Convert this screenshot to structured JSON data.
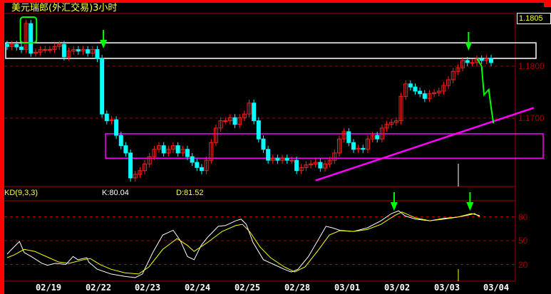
{
  "title": "美元瑞郎(外汇交易)3小时",
  "last_price": "1.1805",
  "colors": {
    "up": "#ff2020",
    "down": "#00ffff",
    "k_line": "#ffffff",
    "d_line": "#ffff00",
    "grid": "#a00000",
    "marker": "#00ff00",
    "support_box": "#ff00ff",
    "resistance_box": "#ffffff",
    "frame": "#ff0000"
  },
  "chart_data": [
    {
      "type": "candlestick",
      "title": "美元瑞郎(外汇交易)3小时",
      "y_ticks": [
        "1.1800",
        "1.1700"
      ],
      "y_tick_values": [
        1.18,
        1.17
      ],
      "x_ticks": [
        "02/19",
        "02/22",
        "02/23",
        "02/24",
        "02/25",
        "02/28",
        "03/01",
        "03/02",
        "03/03",
        "03/04"
      ],
      "grid": "horizontal dashed",
      "closes": [
        1.1838,
        1.1842,
        1.1837,
        1.1832,
        1.1882,
        1.1825,
        1.1827,
        1.1832,
        1.1832,
        1.1832,
        1.1838,
        1.1842,
        1.1818,
        1.1829,
        1.1832,
        1.1829,
        1.1832,
        1.1825,
        1.1832,
        1.1815,
        1.1708,
        1.1695,
        1.1697,
        1.1667,
        1.1647,
        1.1633,
        1.1585,
        1.1592,
        1.1599,
        1.1612,
        1.1626,
        1.164,
        1.1647,
        1.1633,
        1.164,
        1.1647,
        1.1633,
        1.164,
        1.1626,
        1.1615,
        1.1605,
        1.1599,
        1.1619,
        1.1653,
        1.1681,
        1.1695,
        1.1695,
        1.1701,
        1.1688,
        1.1701,
        1.1708,
        1.1729,
        1.1695,
        1.166,
        1.164,
        1.1619,
        1.1623,
        1.1619,
        1.1623,
        1.1619,
        1.1619,
        1.1599,
        1.1605,
        1.161,
        1.1612,
        1.1615,
        1.1604,
        1.1612,
        1.1619,
        1.1633,
        1.166,
        1.1674,
        1.1653,
        1.164,
        1.1642,
        1.164,
        1.166,
        1.1667,
        1.166,
        1.1681,
        1.1688,
        1.1692,
        1.1695,
        1.1742,
        1.1766,
        1.176,
        1.1752,
        1.1747,
        1.1738,
        1.1747,
        1.1749,
        1.1752,
        1.1763,
        1.1774,
        1.179,
        1.1797,
        1.1811,
        1.1807,
        1.1807,
        1.1814,
        1.1811,
        1.1815,
        1.1807
      ],
      "annotations": {
        "resistance_box": {
          "price_top": 1.1845,
          "price_bottom": 1.1815
        },
        "support_box": {
          "price_top": 1.167,
          "price_bottom": 1.1623
        },
        "trend_line": [
          [
            65,
            1.158
          ],
          [
            111,
            1.172
          ]
        ],
        "projection": [
          [
            99,
            1.1815
          ],
          [
            100,
            1.18
          ],
          [
            100.5,
            1.1745
          ],
          [
            101,
            1.175
          ],
          [
            101.5,
            1.1755
          ],
          [
            102,
            1.172
          ],
          [
            102.5,
            1.169
          ]
        ],
        "arrows_at_bar": [
          20,
          98
        ],
        "highlight_bars": [
          4,
          5
        ]
      }
    },
    {
      "type": "line",
      "title": "KD(9,3,3)",
      "y_ticks": [
        "80",
        "50",
        "20"
      ],
      "y_tick_values": [
        80,
        50,
        20
      ],
      "series": [
        {
          "name": "K",
          "label": "K:80.04",
          "points": [
            [
              0,
              33
            ],
            [
              0.7,
              37.5
            ],
            [
              2.6,
              49
            ],
            [
              3.6,
              35
            ],
            [
              5.1,
              30
            ],
            [
              7.3,
              21.5
            ],
            [
              8.5,
              19
            ],
            [
              10.2,
              21.5
            ],
            [
              12.4,
              20
            ],
            [
              13.9,
              30
            ],
            [
              14.9,
              26
            ],
            [
              16.8,
              28.5
            ],
            [
              17.2,
              23
            ],
            [
              19,
              14
            ],
            [
              21.9,
              8
            ],
            [
              24.8,
              5
            ],
            [
              27,
              3.5
            ],
            [
              28.5,
              8
            ],
            [
              30.7,
              35
            ],
            [
              32.8,
              57
            ],
            [
              35,
              63
            ],
            [
              36.5,
              50
            ],
            [
              38,
              30
            ],
            [
              39.4,
              26
            ],
            [
              40.9,
              44
            ],
            [
              42.3,
              54.5
            ],
            [
              44.5,
              68
            ],
            [
              46,
              69
            ],
            [
              48.2,
              75
            ],
            [
              49.3,
              77
            ],
            [
              50.4,
              70.5
            ],
            [
              51.8,
              48
            ],
            [
              54,
              26
            ],
            [
              56.2,
              20
            ],
            [
              58.4,
              14
            ],
            [
              59.9,
              10.5
            ],
            [
              61.3,
              14
            ],
            [
              63.5,
              30
            ],
            [
              65.7,
              52.5
            ],
            [
              67.2,
              68
            ],
            [
              68.6,
              66
            ],
            [
              70.1,
              63
            ],
            [
              73,
              61.5
            ],
            [
              75.9,
              66
            ],
            [
              78.8,
              75
            ],
            [
              81,
              84
            ],
            [
              82.5,
              87.5
            ],
            [
              83.9,
              81
            ],
            [
              86.1,
              77
            ],
            [
              89.1,
              75
            ],
            [
              92,
              78
            ],
            [
              94.9,
              79.5
            ],
            [
              97.1,
              82
            ],
            [
              98.5,
              84
            ],
            [
              99.6,
              80.04
            ]
          ]
        },
        {
          "name": "D",
          "label": "D:81.52",
          "points": [
            [
              0,
              28.5
            ],
            [
              1.5,
              32
            ],
            [
              3.6,
              39
            ],
            [
              5.8,
              36.5
            ],
            [
              8.8,
              28.5
            ],
            [
              10.9,
              23
            ],
            [
              13.1,
              21.5
            ],
            [
              16.1,
              26
            ],
            [
              17.5,
              27.5
            ],
            [
              19.7,
              19.5
            ],
            [
              21.9,
              14
            ],
            [
              24.8,
              9.5
            ],
            [
              27.7,
              8
            ],
            [
              29.9,
              17
            ],
            [
              32.8,
              39
            ],
            [
              35.8,
              52.5
            ],
            [
              38,
              44
            ],
            [
              39.4,
              36.5
            ],
            [
              42.3,
              48
            ],
            [
              45.3,
              61.5
            ],
            [
              48.2,
              69
            ],
            [
              49.6,
              70.5
            ],
            [
              51.1,
              61.5
            ],
            [
              53.3,
              42
            ],
            [
              55.5,
              28.5
            ],
            [
              58.4,
              17
            ],
            [
              60.6,
              10.5
            ],
            [
              62.8,
              17
            ],
            [
              65.7,
              39
            ],
            [
              67.9,
              57
            ],
            [
              70.1,
              62.5
            ],
            [
              73,
              61.5
            ],
            [
              75.9,
              64
            ],
            [
              78.8,
              70.5
            ],
            [
              81.8,
              82
            ],
            [
              83.2,
              86
            ],
            [
              86.1,
              78.5
            ],
            [
              89.1,
              75
            ],
            [
              92,
              77
            ],
            [
              94.9,
              79.5
            ],
            [
              97.8,
              84
            ],
            [
              99.6,
              81.52
            ]
          ]
        }
      ],
      "arrows_at_bar": [
        82,
        98
      ]
    }
  ]
}
